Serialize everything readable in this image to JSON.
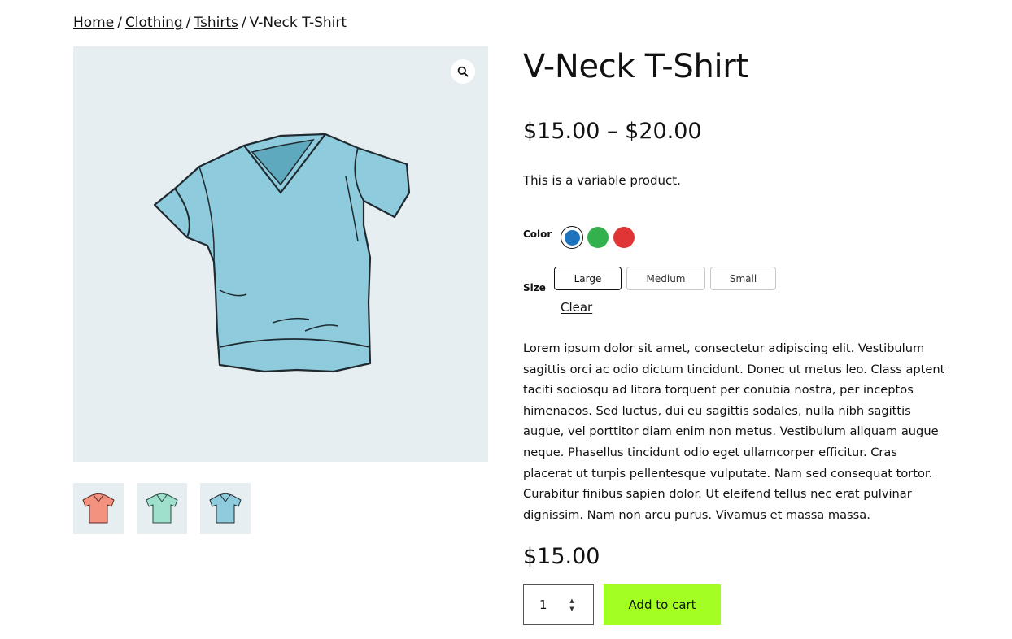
{
  "breadcrumb": {
    "items": [
      {
        "label": "Home"
      },
      {
        "label": "Clothing"
      },
      {
        "label": "Tshirts"
      }
    ],
    "separator": "/",
    "current": "V-Neck T-Shirt"
  },
  "gallery": {
    "zoom_icon": "magnifier-icon",
    "main_image": {
      "icon": "tshirt-blue-icon",
      "color": "#8ecbdc"
    },
    "thumbnails": [
      {
        "icon": "tshirt-red-icon",
        "color": "#f2927f"
      },
      {
        "icon": "tshirt-green-icon",
        "color": "#9fe0cc"
      },
      {
        "icon": "tshirt-blue-icon",
        "color": "#8ecbdc"
      }
    ]
  },
  "product": {
    "title": "V-Neck T-Shirt",
    "price_range": "$15.00 – $20.00",
    "short_description": "This is a variable product.",
    "options": {
      "color_label": "Color",
      "colors": [
        {
          "hex": "#1e73be",
          "selected": true
        },
        {
          "hex": "#33b14d",
          "selected": false
        },
        {
          "hex": "#e03535",
          "selected": false
        }
      ],
      "size_label": "Size",
      "sizes": [
        {
          "label": "Large",
          "selected": true
        },
        {
          "label": "Medium",
          "selected": false
        },
        {
          "label": "Small",
          "selected": false
        }
      ],
      "clear_label": "Clear"
    },
    "description": "Lorem ipsum dolor sit amet, consectetur adipiscing elit. Vestibulum sagittis orci ac odio dictum tincidunt. Donec ut metus leo. Class aptent taciti sociosqu ad litora torquent per conubia nostra, per inceptos himenaeos. Sed luctus, dui eu sagittis sodales, nulla nibh sagittis augue, vel porttitor diam enim non metus. Vestibulum aliquam augue neque. Phasellus tincidunt odio eget ullamcorper efficitur. Cras placerat ut turpis pellentesque vulputate. Nam sed consequat tortor. Curabitur finibus sapien dolor. Ut eleifend tellus nec erat pulvinar dignissim. Nam non arcu purus. Vivamus et massa massa.",
    "variation_price": "$15.00",
    "quantity": "1",
    "add_to_cart_label": "Add to cart",
    "add_to_cart_color": "#a3ff22"
  }
}
